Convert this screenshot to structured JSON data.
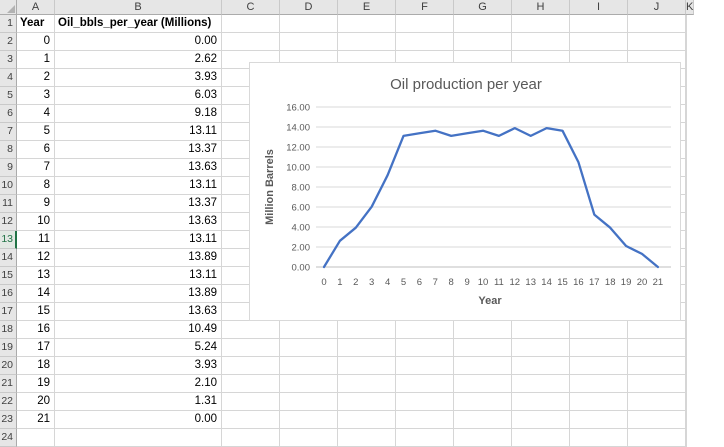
{
  "app": {
    "type": "spreadsheet-with-embedded-chart"
  },
  "sheet": {
    "column_letters": [
      "A",
      "B",
      "C",
      "D",
      "E",
      "F",
      "G",
      "H",
      "I",
      "J",
      "K"
    ],
    "row_numbers": [
      1,
      2,
      3,
      4,
      5,
      6,
      7,
      8,
      9,
      10,
      11,
      12,
      13,
      14,
      15,
      16,
      17,
      18,
      19,
      20,
      21,
      22,
      23,
      24
    ],
    "selected_row": 13,
    "columns": {
      "a_header": "Year",
      "b_header": "Oil_bbls_per_year (Millions)"
    },
    "rows": [
      {
        "row": 2,
        "year": "0",
        "value": "0.00"
      },
      {
        "row": 3,
        "year": "1",
        "value": "2.62"
      },
      {
        "row": 4,
        "year": "2",
        "value": "3.93"
      },
      {
        "row": 5,
        "year": "3",
        "value": "6.03"
      },
      {
        "row": 6,
        "year": "4",
        "value": "9.18"
      },
      {
        "row": 7,
        "year": "5",
        "value": "13.11"
      },
      {
        "row": 8,
        "year": "6",
        "value": "13.37"
      },
      {
        "row": 9,
        "year": "7",
        "value": "13.63"
      },
      {
        "row": 10,
        "year": "8",
        "value": "13.11"
      },
      {
        "row": 11,
        "year": "9",
        "value": "13.37"
      },
      {
        "row": 12,
        "year": "10",
        "value": "13.63"
      },
      {
        "row": 13,
        "year": "11",
        "value": "13.11"
      },
      {
        "row": 14,
        "year": "12",
        "value": "13.89"
      },
      {
        "row": 15,
        "year": "13",
        "value": "13.11"
      },
      {
        "row": 16,
        "year": "14",
        "value": "13.89"
      },
      {
        "row": 17,
        "year": "15",
        "value": "13.63"
      },
      {
        "row": 18,
        "year": "16",
        "value": "10.49"
      },
      {
        "row": 19,
        "year": "17",
        "value": "5.24"
      },
      {
        "row": 20,
        "year": "18",
        "value": "3.93"
      },
      {
        "row": 21,
        "year": "19",
        "value": "2.10"
      },
      {
        "row": 22,
        "year": "20",
        "value": "1.31"
      },
      {
        "row": 23,
        "year": "21",
        "value": "0.00"
      }
    ]
  },
  "chart_data": {
    "type": "line",
    "title": "Oil production per year",
    "xlabel": "Year",
    "ylabel": "Million Barrels",
    "x": [
      0,
      1,
      2,
      3,
      4,
      5,
      6,
      7,
      8,
      9,
      10,
      11,
      12,
      13,
      14,
      15,
      16,
      17,
      18,
      19,
      20,
      21
    ],
    "values": [
      0.0,
      2.62,
      3.93,
      6.03,
      9.18,
      13.11,
      13.37,
      13.63,
      13.11,
      13.37,
      13.63,
      13.11,
      13.89,
      13.11,
      13.89,
      13.63,
      10.49,
      5.24,
      3.93,
      2.1,
      1.31,
      0.0
    ],
    "ylim": [
      0,
      16
    ],
    "y_tick_step": 2,
    "y_tick_decimals": 2,
    "grid": "horizontal",
    "legend": "none",
    "line_color": "#4472C4",
    "gridline_color": "#D9D9D9",
    "axis_color": "#BFBFBF",
    "text_color": "#595959"
  },
  "colors": {
    "selection_green": "#217346",
    "header_bg": "#E6E6E6",
    "grid_line": "#D6D6D6"
  }
}
